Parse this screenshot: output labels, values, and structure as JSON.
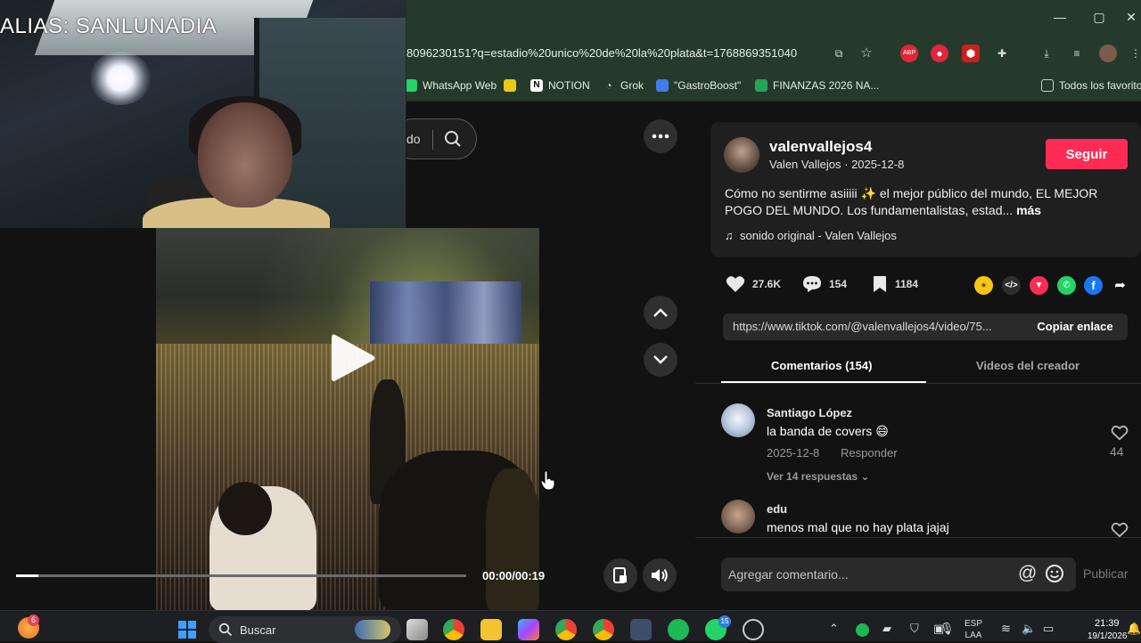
{
  "browser": {
    "url": "8096230151?q=estadio%20unico%20de%20la%20plata&t=1768869351040",
    "window_controls": {
      "minimize": "—",
      "maximize": "▢",
      "close": "✕"
    },
    "toolbar": {
      "abp_label": "ABP"
    },
    "bookmarks": [
      {
        "label": "WhatsApp Web"
      },
      {
        "label": "NOTION"
      },
      {
        "label": "Grok"
      },
      {
        "label": "\"GastroBoost\""
      },
      {
        "label": "FINANZAS 2026 NA..."
      }
    ],
    "all_bookmarks": "Todos los favoritos"
  },
  "webcam": {
    "alias": "ALIAS: SANLUNADIA"
  },
  "video": {
    "search_fragment": "do",
    "time": "00:00/00:19",
    "progress": 0.05
  },
  "post": {
    "username": "valenvallejos4",
    "display_name": "Valen Vallejos",
    "date": "2025-12-8",
    "separator": "·",
    "follow_label": "Seguir",
    "caption": "Cómo no sentirme asiiiii ✨ el mejor público del mundo, EL MEJOR POGO DEL MUNDO. Los fundamentalistas, estad...",
    "more_label": "más",
    "music": "sonido original - Valen Vallejos",
    "likes": "27.6K",
    "comments": "154",
    "saves": "1184",
    "link": "https://www.tiktok.com/@valenvallejos4/video/75...",
    "copy_label": "Copiar enlace",
    "share_embed": "</>"
  },
  "tabs": [
    {
      "label": "Comentarios (154)"
    },
    {
      "label": "Videos del creador"
    }
  ],
  "comments": [
    {
      "author": "Santiago López",
      "text": "la banda de covers 😄",
      "date": "2025-12-8",
      "reply_label": "Responder",
      "likes": "44",
      "replies_label": "Ver 14 respuestas"
    },
    {
      "author": "edu",
      "text": "menos mal que no hay plata jajaj"
    }
  ],
  "composer": {
    "placeholder": "Agregar comentario...",
    "mention": "@",
    "publish_label": "Publicar"
  },
  "taskbar": {
    "notification_count": "6",
    "search_label": "Buscar",
    "whatsapp_badge": "15",
    "lang_top": "ESP",
    "lang_bottom": "LAA",
    "time": "21:39",
    "date": "19/1/2026"
  },
  "colors": {
    "accent": "#fe2c55",
    "chrome": "#253a2b",
    "panel": "#1f1f1f"
  }
}
